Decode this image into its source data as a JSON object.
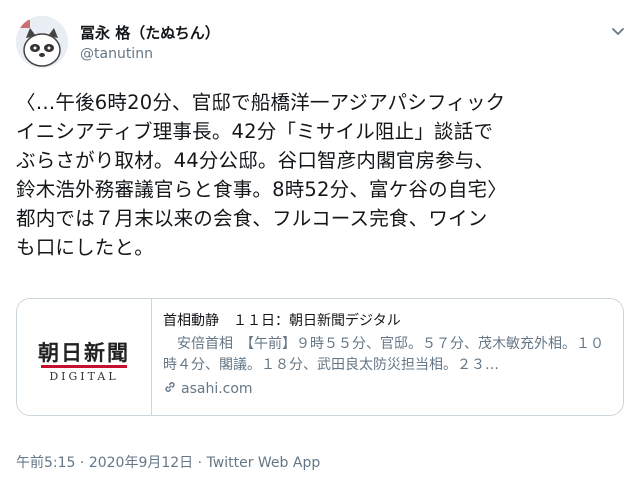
{
  "user": {
    "display_name": "冨永 格（たぬちん）",
    "handle": "@tanutinn"
  },
  "tweet": {
    "text": "〈…午後6時20分、官邸で船橋洋一アジアパシフィック\nイニシアティブ理事長。42分「ミサイル阻止」談話で\nぶらさがり取材。44分公邸。谷口智彦内閣官房参与、\n鈴木浩外務審議官らと食事。8時52分、富ケ谷の自宅〉\n都内では７月末以来の会食、フルコース完食、ワイン\nも口にしたと。"
  },
  "card": {
    "logo_ja": "朝日新聞",
    "logo_en": "DIGITAL",
    "title": "首相動静　１１日：朝日新聞デジタル",
    "description": "安倍首相　【午前】９時５５分、官邸。５７分、茂木敏充外相。１０時４分、閣議。１８分、武田良太防災担当相。２３…",
    "domain": "asahi.com"
  },
  "meta": {
    "time": "午前5:15",
    "date": "2020年9月12日",
    "separator": "·",
    "source": "Twitter Web App"
  },
  "icons": [
    "avatar-raccoon",
    "chevron-down-icon",
    "link-icon"
  ],
  "colors": {
    "text": "#14171a",
    "secondary": "#657786",
    "border": "#ccd6dd",
    "logo_red": "#c8102e"
  }
}
